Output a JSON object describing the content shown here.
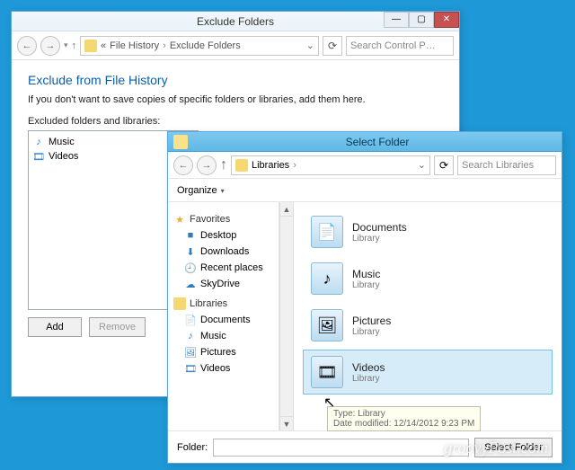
{
  "win1": {
    "title": "Exclude Folders",
    "breadcrumb": {
      "root_icon": "«",
      "seg1": "File History",
      "seg2": "Exclude Folders"
    },
    "search_placeholder": "Search Control P…",
    "heading": "Exclude from File History",
    "subtext": "If you don't want to save copies of specific folders or libraries, add them here.",
    "list_label": "Excluded folders and libraries:",
    "excluded": [
      {
        "icon": "♪",
        "name": "Music"
      },
      {
        "icon": "🎞",
        "name": "Videos"
      }
    ],
    "add_label": "Add",
    "remove_label": "Remove"
  },
  "win2": {
    "title": "Select Folder",
    "breadcrumb": {
      "seg1": "Libraries"
    },
    "search_placeholder": "Search Libraries",
    "organize_label": "Organize",
    "sidebar": {
      "fav_header": "Favorites",
      "fav": [
        "Desktop",
        "Downloads",
        "Recent places",
        "SkyDrive"
      ],
      "lib_header": "Libraries",
      "lib": [
        "Documents",
        "Music",
        "Pictures",
        "Videos"
      ]
    },
    "libraries": [
      {
        "icon": "📄",
        "name": "Documents",
        "type": "Library"
      },
      {
        "icon": "♪",
        "name": "Music",
        "type": "Library"
      },
      {
        "icon": "🖼",
        "name": "Pictures",
        "type": "Library"
      },
      {
        "icon": "🎞",
        "name": "Videos",
        "type": "Library"
      }
    ],
    "selected_index": 3,
    "tooltip": {
      "line1": "Type: Library",
      "line2": "Date modified: 12/14/2012 9:23 PM"
    },
    "folder_label": "Folder:",
    "select_button": "Select Folder"
  },
  "watermark": "groovyPost.com"
}
